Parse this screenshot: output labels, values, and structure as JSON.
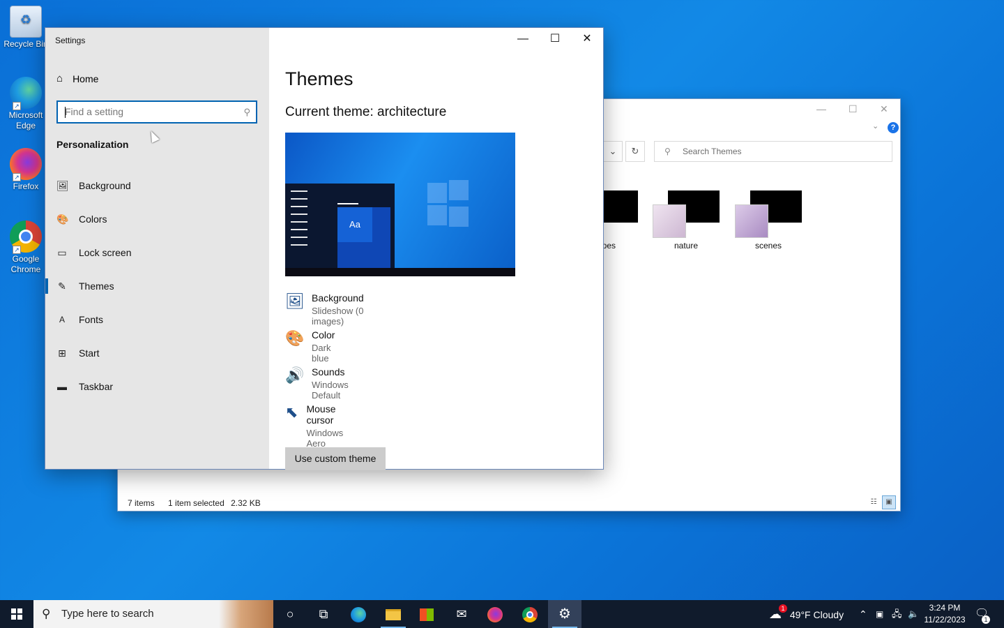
{
  "desktop": {
    "icons": [
      {
        "label": "Recycle Bin",
        "icon": "recycle-bin-icon"
      },
      {
        "label": "Microsoft Edge",
        "icon": "edge-icon"
      },
      {
        "label": "Firefox",
        "icon": "firefox-icon"
      },
      {
        "label": "Google Chrome",
        "icon": "chrome-icon"
      }
    ]
  },
  "explorer": {
    "search_placeholder": "Search Themes",
    "items": [
      {
        "label": "capes"
      },
      {
        "label": "nature"
      },
      {
        "label": "scenes"
      }
    ],
    "status": {
      "count": "7 items",
      "selected": "1 item selected",
      "size": "2.32 KB"
    }
  },
  "settings": {
    "title": "Settings",
    "home_label": "Home",
    "search_placeholder": "Find a setting",
    "section_heading": "Personalization",
    "nav": [
      {
        "label": "Background",
        "icon": "picture-icon"
      },
      {
        "label": "Colors",
        "icon": "palette-icon"
      },
      {
        "label": "Lock screen",
        "icon": "lock-screen-icon"
      },
      {
        "label": "Themes",
        "icon": "brush-icon",
        "selected": true
      },
      {
        "label": "Fonts",
        "icon": "font-icon"
      },
      {
        "label": "Start",
        "icon": "start-icon"
      },
      {
        "label": "Taskbar",
        "icon": "taskbar-icon"
      }
    ],
    "page_title": "Themes",
    "current_theme": "Current theme: architecture",
    "preview_tile_text": "Aa",
    "properties": [
      {
        "name": "Background",
        "value": "Slideshow (0 images)",
        "icon": "picture-icon"
      },
      {
        "name": "Color",
        "value": "Dark blue",
        "icon": "palette-icon"
      },
      {
        "name": "Sounds",
        "value": "Windows Default",
        "icon": "speaker-icon"
      },
      {
        "name": "Mouse cursor",
        "value": "Windows Aero",
        "icon": "cursor-icon"
      }
    ],
    "custom_button": "Use custom theme"
  },
  "taskbar": {
    "search_placeholder": "Type here to search",
    "weather": "49°F  Cloudy",
    "weather_badge": "1",
    "time": "3:24 PM",
    "date": "11/22/2023",
    "notification_count": "1"
  },
  "colors": {
    "accent": "#0063b1",
    "sidebar_bg": "#e6e6e6",
    "taskbar_bg": "#101b2c"
  }
}
